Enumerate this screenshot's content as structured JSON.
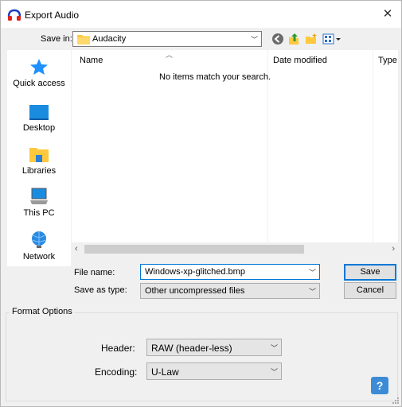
{
  "window": {
    "title": "Export Audio",
    "close_glyph": "✕"
  },
  "location": {
    "label": "Save in:",
    "value": "Audacity"
  },
  "toolbar": {
    "icons": [
      "back-icon",
      "up-folder-icon",
      "new-folder-icon",
      "view-menu-icon"
    ]
  },
  "places": [
    {
      "label": "Quick access",
      "icon": "quick-access-icon"
    },
    {
      "label": "Desktop",
      "icon": "desktop-icon"
    },
    {
      "label": "Libraries",
      "icon": "libraries-icon"
    },
    {
      "label": "This PC",
      "icon": "this-pc-icon"
    },
    {
      "label": "Network",
      "icon": "network-icon"
    }
  ],
  "filelist": {
    "columns": [
      "Name",
      "Date modified",
      "Type"
    ],
    "empty_message": "No items match your search."
  },
  "file_name": {
    "label": "File name:",
    "value": "Windows-xp-glitched.bmp"
  },
  "save_type": {
    "label": "Save as type:",
    "value": "Other uncompressed files"
  },
  "buttons": {
    "save": "Save",
    "cancel": "Cancel"
  },
  "format_options": {
    "title": "Format Options",
    "header_label": "Header:",
    "header_value": "RAW (header-less)",
    "encoding_label": "Encoding:",
    "encoding_value": "U-Law"
  },
  "help": {
    "glyph": "?"
  },
  "colors": {
    "accent": "#0078d7",
    "folder": "#ffc83d"
  }
}
